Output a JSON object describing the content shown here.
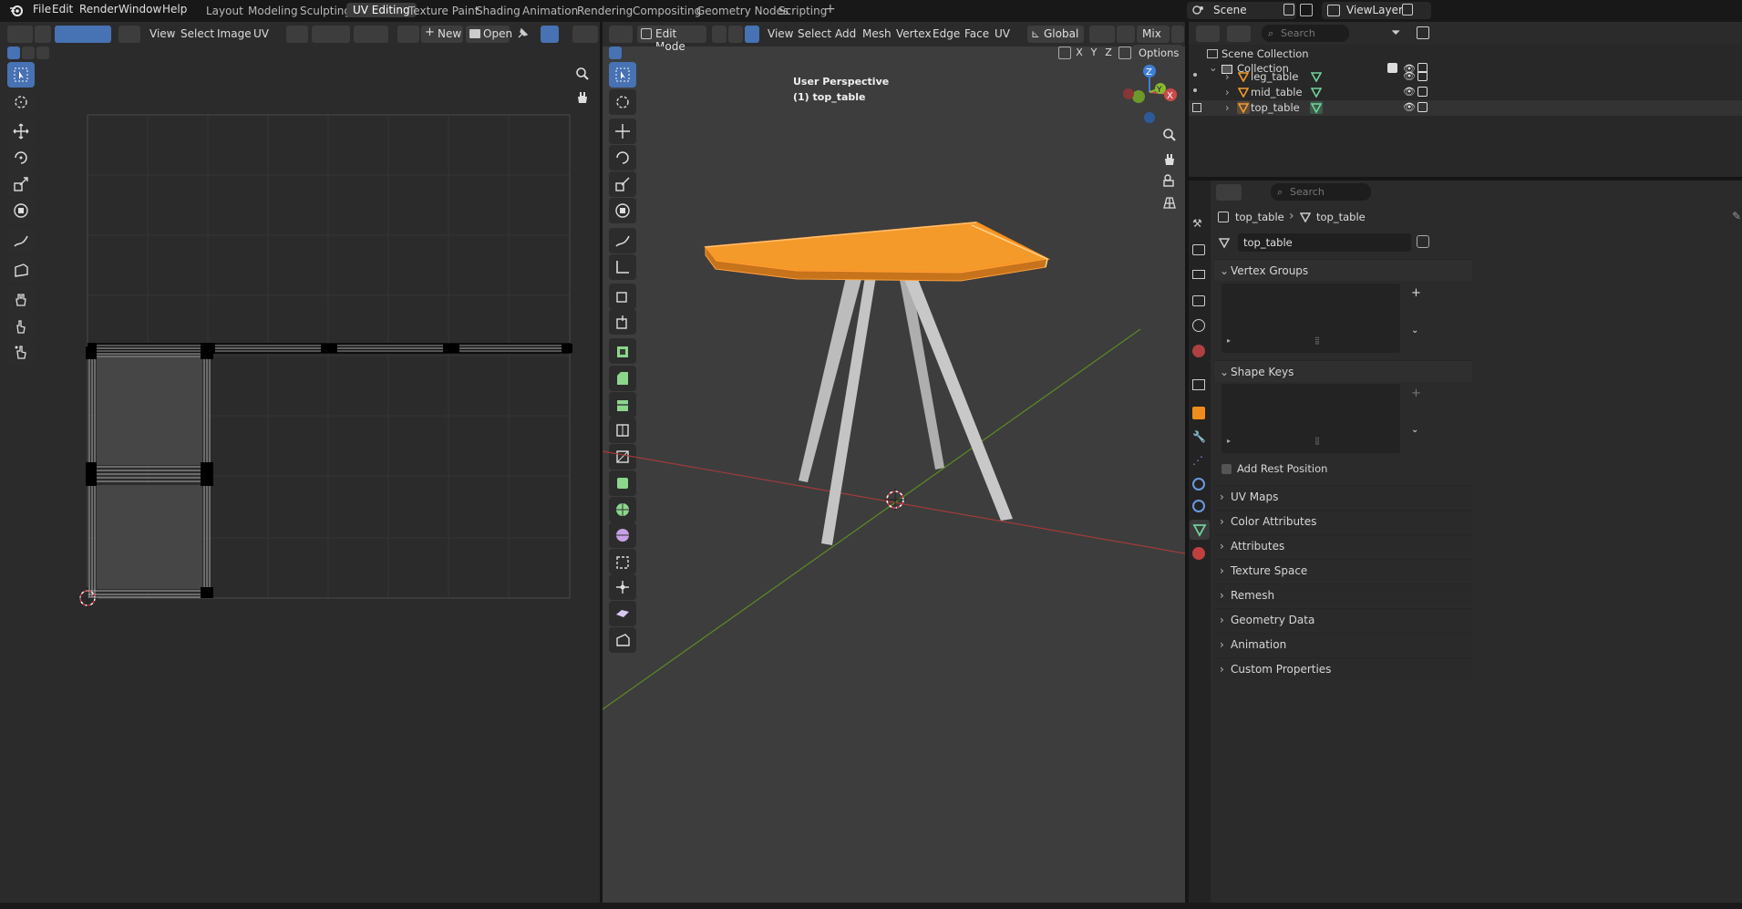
{
  "topbar": {
    "menus": [
      "File",
      "Edit",
      "Render",
      "Window",
      "Help"
    ],
    "workspaces": [
      "Layout",
      "Modeling",
      "Sculpting",
      "UV Editing",
      "Texture Paint",
      "Shading",
      "Animation",
      "Rendering",
      "Compositing",
      "Geometry Nodes",
      "Scripting",
      "+"
    ],
    "active_workspace": "UV Editing",
    "scene": "Scene",
    "view_layer": "ViewLayer"
  },
  "uv_editor": {
    "menus": [
      "View",
      "Select",
      "Image",
      "UV"
    ],
    "new_label": "New",
    "open_label": "Open"
  },
  "viewport": {
    "mode": "Edit Mode",
    "menus": [
      "View",
      "Select",
      "Add",
      "Mesh",
      "Vertex",
      "Edge",
      "Face",
      "UV"
    ],
    "transform_orientation": "Global",
    "shading_mix": "Mix",
    "axis_x": "X",
    "axis_y": "Y",
    "axis_z": "Z",
    "options_label": "Options",
    "overlay_line1": "User Perspective",
    "overlay_line2": "(1) top_table",
    "gizmo": {
      "x": "X",
      "y": "Y",
      "z": "Z"
    }
  },
  "outliner": {
    "search_placeholder": "Search",
    "scene_collection": "Scene Collection",
    "collection": "Collection",
    "objects": [
      "leg_table",
      "mid_table",
      "top_table"
    ]
  },
  "properties": {
    "search_placeholder": "Search",
    "breadcrumb_object": "top_table",
    "breadcrumb_mesh": "top_table",
    "mesh_name": "top_table",
    "vertex_groups": "Vertex Groups",
    "shape_keys": "Shape Keys",
    "add_rest_position": "Add Rest Position",
    "panels": [
      "UV Maps",
      "Color Attributes",
      "Attributes",
      "Texture Space",
      "Remesh",
      "Geometry Data",
      "Animation",
      "Custom Properties"
    ]
  },
  "colors": {
    "accent": "#4772b3",
    "selected_orange": "#f08c1c",
    "x_axis": "#cc4a4a",
    "y_axis": "#8ab832",
    "z_axis": "#3f7ed8"
  }
}
